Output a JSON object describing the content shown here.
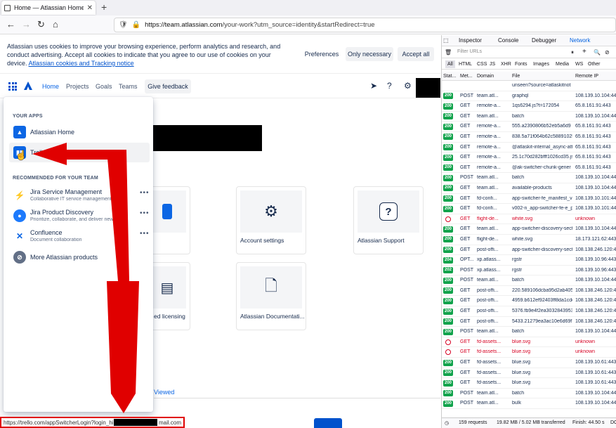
{
  "browser": {
    "tab_title": "Home — Atlassian Home",
    "new_tab": "+",
    "url_host": "https://team.atlassian.com",
    "url_path": "/your-work?utm_source=identity&startRedirect=true"
  },
  "cookie_banner": {
    "text": "Atlassian uses cookies to improve your browsing experience, perform analytics and research, and conduct advertising. Accept all cookies to indicate that you agree to our use of cookies on your device.",
    "link": "Atlassian cookies and Tracking notice",
    "preferences": "Preferences",
    "only_necessary": "Only necessary",
    "accept_all": "Accept all"
  },
  "topnav": {
    "home": "Home",
    "projects": "Projects",
    "goals": "Goals",
    "teams": "Teams",
    "feedback": "Give feedback"
  },
  "tiles": [
    {
      "label": ""
    },
    {
      "label": "Account settings"
    },
    {
      "label": "Atlassian Support"
    },
    {
      "label": "ed licensing"
    },
    {
      "label": "Atlassian Documentati..."
    }
  ],
  "viewed_tab": "Viewed",
  "switcher": {
    "your_apps_heading": "YOUR APPS",
    "recommended_heading": "RECOMMENDED FOR YOUR TEAM",
    "apps": [
      {
        "title": "Atlassian Home"
      },
      {
        "title": "Trello"
      }
    ],
    "recommended": [
      {
        "title": "Jira Service Management",
        "subtitle": "Collaborative IT service management"
      },
      {
        "title": "Jira Product Discovery",
        "subtitle": "Prioritize, collaborate, and deliver new"
      },
      {
        "title": "Confluence",
        "subtitle": "Document collaboration"
      }
    ],
    "more": "More Atlassian products"
  },
  "statusbar": {
    "left": "https://trello.com/appSwitcherLogin?login_hint=",
    "right": "mail.com"
  },
  "devtools": {
    "tabs": [
      "Inspector",
      "Console",
      "Debugger",
      "Network"
    ],
    "selected_tab": "Network",
    "filter_placeholder": "Filter URLs",
    "types": [
      "All",
      "HTML",
      "CSS",
      "JS",
      "XHR",
      "Fonts",
      "Images",
      "Media",
      "WS",
      "Other"
    ],
    "columns": [
      "Stat...",
      "Met...",
      "Domain",
      "File",
      "Remote IP"
    ],
    "rows": [
      {
        "status": "",
        "method": "",
        "domain": "",
        "file": "unseen?source=atlaskitnot",
        "ip": ""
      },
      {
        "status": "200",
        "method": "POST",
        "domain": "team.atl...",
        "file": "graphql",
        "ip": "108.139.10.104:443"
      },
      {
        "status": "200",
        "method": "GET",
        "domain": "remote-a...",
        "file": "1qs6294.js?t=172054",
        "ip": "65.8.161.91:443"
      },
      {
        "status": "200",
        "method": "GET",
        "domain": "team.atl...",
        "file": "batch",
        "ip": "108.139.10.104:443"
      },
      {
        "status": "200",
        "method": "GET",
        "domain": "remote-a...",
        "file": "555.a2390806b52eb5a6d9",
        "ip": "65.8.161.91:443"
      },
      {
        "status": "200",
        "method": "GET",
        "domain": "remote-a...",
        "file": "838.5a71f064b62c58891025",
        "ip": "65.8.161.91:443"
      },
      {
        "status": "200",
        "method": "GET",
        "domain": "remote-a...",
        "file": "@atlaskit-internal_async-att",
        "ip": "65.8.161.91:443"
      },
      {
        "status": "200",
        "method": "GET",
        "domain": "remote-a...",
        "file": "25.1c70d282bfff1026cd35.js",
        "ip": "65.8.161.91:443"
      },
      {
        "status": "200",
        "method": "GET",
        "domain": "remote-a...",
        "file": "@ak-switcher-chunk-gener",
        "ip": "65.8.161.91:443"
      },
      {
        "status": "200",
        "method": "POST",
        "domain": "team.atl...",
        "file": "batch",
        "ip": "108.139.10.104:443"
      },
      {
        "status": "200",
        "method": "GET",
        "domain": "team.atl...",
        "file": "available-products",
        "ip": "108.139.10.104:443"
      },
      {
        "status": "200",
        "method": "GET",
        "domain": "fd-confi...",
        "file": "app-switcher-fe_manifest_v",
        "ip": "108.139.10.101:443"
      },
      {
        "status": "200",
        "method": "GET",
        "domain": "fd-confi...",
        "file": "v002-n_app-switcher-fe-e_p",
        "ip": "108.139.10.101:443"
      },
      {
        "status": "blocked",
        "method": "GET",
        "domain": "flight-de...",
        "file": "white.svg",
        "ip": "unknown"
      },
      {
        "status": "200",
        "method": "GET",
        "domain": "team.atl...",
        "file": "app-switcher-discovery-sect",
        "ip": "108.139.10.104:443"
      },
      {
        "status": "200",
        "method": "GET",
        "domain": "flight-de...",
        "file": "white.svg",
        "ip": "18.173.121.62:443"
      },
      {
        "status": "200",
        "method": "GET",
        "domain": "post-offi...",
        "file": "app-switcher-discovery-sect",
        "ip": "108.138.246.120:443"
      },
      {
        "status": "204",
        "method": "OPT...",
        "domain": "xp.atlass...",
        "file": "rgstr",
        "ip": "108.139.10.96:443"
      },
      {
        "status": "202",
        "method": "POST",
        "domain": "xp.atlass...",
        "file": "rgstr",
        "ip": "108.139.10.96:443"
      },
      {
        "status": "200",
        "method": "POST",
        "domain": "team.atl...",
        "file": "batch",
        "ip": "108.139.10.104:443"
      },
      {
        "status": "200",
        "method": "GET",
        "domain": "post-offi...",
        "file": "220.589106dcba95d2ab405f",
        "ip": "108.138.246.120:443"
      },
      {
        "status": "200",
        "method": "GET",
        "domain": "post-offi...",
        "file": "4959.b612ef92403ff8da1cdc",
        "ip": "108.138.246.120:443"
      },
      {
        "status": "200",
        "method": "GET",
        "domain": "post-offi...",
        "file": "5376.fb9e4f2ea3032843953",
        "ip": "108.138.246.120:443"
      },
      {
        "status": "200",
        "method": "GET",
        "domain": "post-offi...",
        "file": "5433.21279ea3ac10e6d69f7",
        "ip": "108.138.246.120:443"
      },
      {
        "status": "200",
        "method": "POST",
        "domain": "team.atl...",
        "file": "batch",
        "ip": "108.139.10.104:443"
      },
      {
        "status": "blocked",
        "method": "GET",
        "domain": "fd-assets...",
        "file": "blue.svg",
        "ip": "unknown"
      },
      {
        "status": "blocked",
        "method": "GET",
        "domain": "fd-assets...",
        "file": "blue.svg",
        "ip": "unknown"
      },
      {
        "status": "200",
        "method": "GET",
        "domain": "fd-assets...",
        "file": "blue.svg",
        "ip": "108.139.10.61:443"
      },
      {
        "status": "200",
        "method": "GET",
        "domain": "fd-assets...",
        "file": "blue.svg",
        "ip": "108.139.10.61:443"
      },
      {
        "status": "200",
        "method": "GET",
        "domain": "fd-assets...",
        "file": "blue.svg",
        "ip": "108.139.10.61:443"
      },
      {
        "status": "200",
        "method": "POST",
        "domain": "team.atl...",
        "file": "batch",
        "ip": "108.139.10.104:443"
      },
      {
        "status": "200",
        "method": "POST",
        "domain": "team.atl...",
        "file": "bulk",
        "ip": "108.139.10.104:443"
      }
    ],
    "footer": {
      "requests": "159 requests",
      "transferred": "19.82 MB / 5.02 MB transferred",
      "finish": "Finish: 44.50 s",
      "tail": "DC"
    }
  },
  "colors": {
    "accent": "#0052cc",
    "arrow": "#e00000",
    "status_ok": "#12a34c"
  }
}
